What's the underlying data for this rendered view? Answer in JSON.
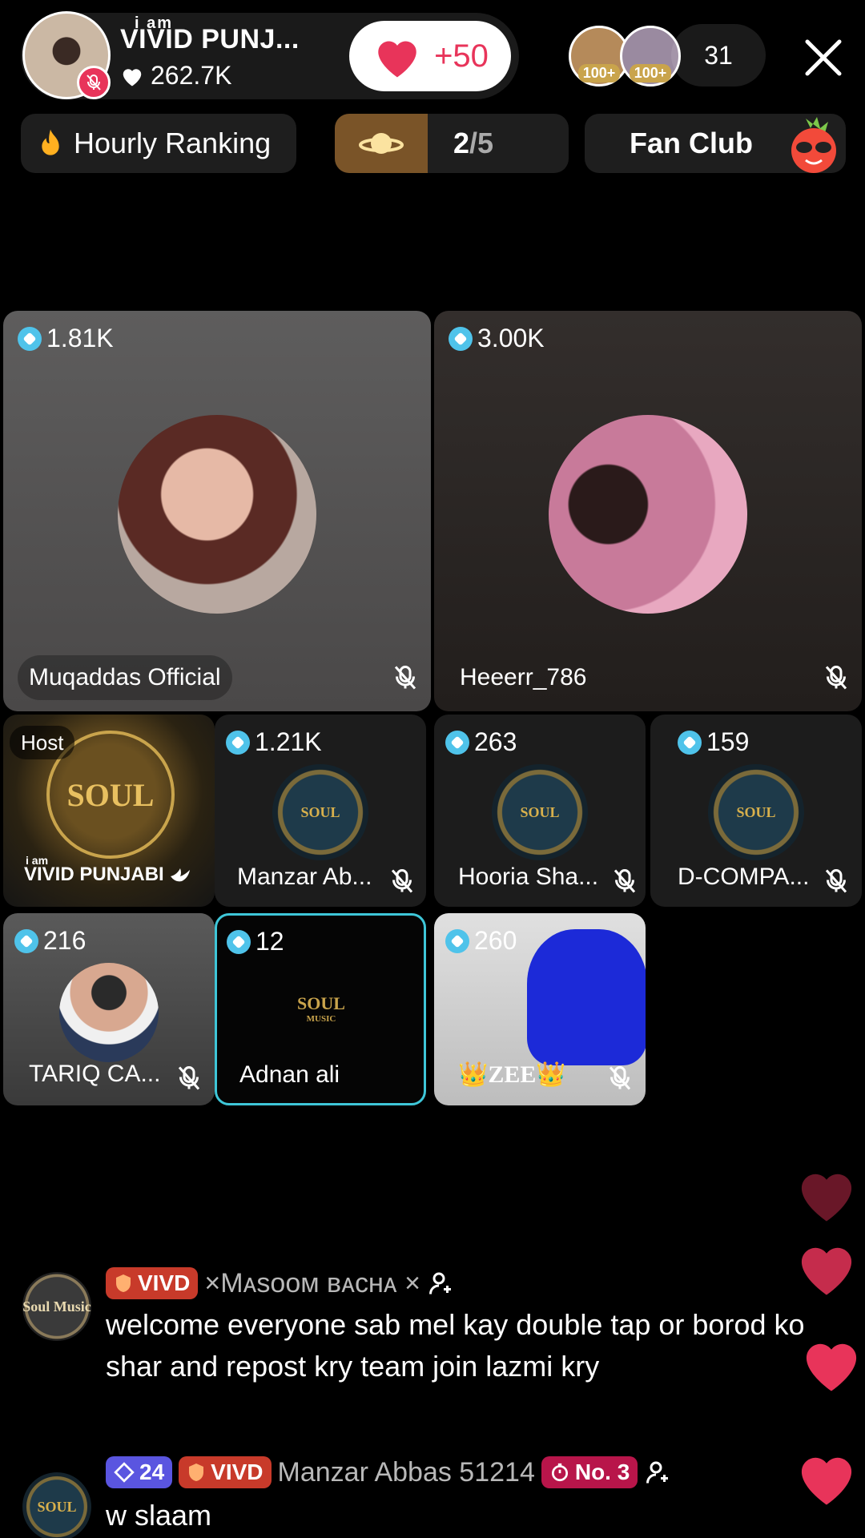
{
  "host": {
    "mini_label": "i  am",
    "name": "VIVID PUNJ...",
    "likes": "262.7K",
    "like_button": "+50"
  },
  "viewers": {
    "avatars": [
      {
        "badge": "100+",
        "color": "#b58a5a"
      },
      {
        "badge": "100+",
        "color": "#9a8aa0"
      }
    ],
    "count": "31"
  },
  "pills": {
    "ranking": "Hourly Ranking",
    "page_current": "2",
    "page_total": "/5",
    "fan_club": "Fan Club"
  },
  "seats_large": [
    {
      "coins": "1.81K",
      "name": "Muqaddas Official"
    },
    {
      "coins": "3.00K",
      "name": "Heeerr_786"
    }
  ],
  "seats_row2": [
    {
      "host_label": "Host",
      "mini": "i  am",
      "name": "VIVID PUNJABI"
    },
    {
      "coins": "1.21K",
      "name": "Manzar Ab..."
    },
    {
      "coins": "263",
      "name": "Hooria Sha..."
    },
    {
      "coins": "159",
      "name": "D-COMPA..."
    }
  ],
  "seats_row3": [
    {
      "coins": "216",
      "name": "TARIQ CA..."
    },
    {
      "coins": "12",
      "name": "Adnan ali"
    },
    {
      "coins": "260",
      "name": "👑ZEE👑"
    }
  ],
  "logo_text": {
    "soul": "SOUL",
    "music": "MUSIC"
  },
  "chat": [
    {
      "avatar_text": "Soul Music",
      "badge_vivd": "VIVD",
      "user": "×Mᴀsᴏᴏᴍ ʙᴀᴄʜᴀ ×",
      "text": "welcome everyone sab mel kay double tap or borod ko shar and repost kry team join lazmi kry"
    },
    {
      "avatar_text": "SOUL",
      "badge_level": "24",
      "badge_vivd": "VIVD",
      "user": "Manzar Abbas 51214",
      "badge_rank": "No. 3",
      "text": "w slaam"
    }
  ],
  "colors": {
    "accent_red": "#e8345a",
    "coin_blue": "#4fc3ea",
    "vivd_badge": "#c83a2a",
    "level_badge": "#5a55e0",
    "rank_badge": "#b8154a"
  }
}
